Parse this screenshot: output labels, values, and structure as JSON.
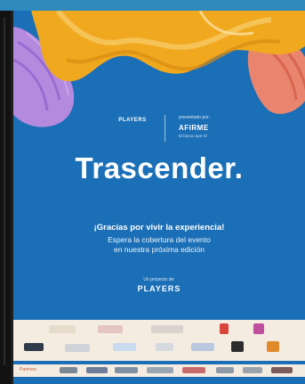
{
  "flyer": {
    "title": "Trascender.",
    "thanks": "¡Gracias por vivir la experiencia!",
    "wait_line1": "Espera la cobertura del evento",
    "wait_line2": "en nuestra próxima edición",
    "project_label": "Un proyecto de:",
    "project_logo": "PLAYERS",
    "players_logo": "PLAYERS",
    "presented_by": "presentado por:",
    "afirme": "AFIRME",
    "afirme_sub": "El banco que Sí",
    "partners_label": "Partners"
  },
  "colors": {
    "background": "#1e1e1e",
    "flyer_blue": "#1b6fb7",
    "top_bar": "#2f89bd",
    "sponsor_band": "#f4ece1",
    "gold": "#f0a81f",
    "purple": "#b48adf",
    "coral": "#e9846e"
  }
}
